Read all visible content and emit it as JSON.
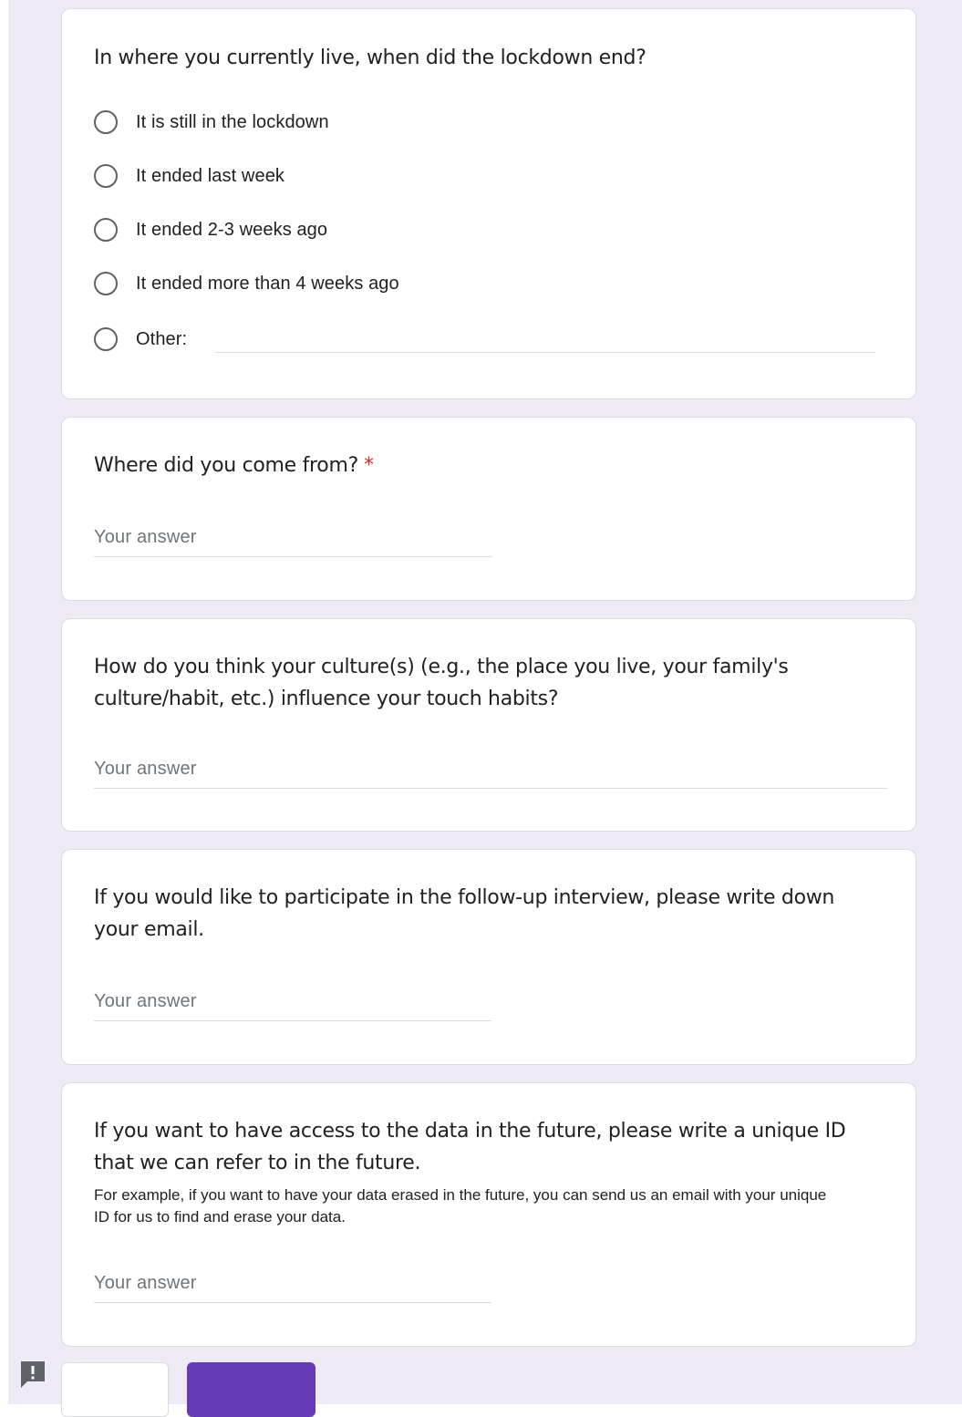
{
  "questions": [
    {
      "title": "In where you currently live, when did the lockdown end?",
      "type": "radio",
      "options": [
        "It is still in the lockdown",
        "It ended last week",
        "It ended 2-3 weeks ago",
        "It ended more than 4 weeks ago",
        "Other:"
      ]
    },
    {
      "title": "Where did you come from?",
      "required_mark": "*",
      "placeholder": "Your answer"
    },
    {
      "title": "How do you think your culture(s) (e.g., the place you live, your family's culture/habit, etc.) influence your touch habits?",
      "placeholder": "Your answer"
    },
    {
      "title": "If you would like to participate in the follow-up interview, please write down your email.",
      "placeholder": "Your answer"
    },
    {
      "title": "If you want to have access to the data in the future, please write a unique ID that we can refer to in the future.",
      "description": "For example, if you want to have your data erased in the future, you can send us an email with your unique ID for us to find and erase your data.",
      "placeholder": "Your answer"
    }
  ],
  "colors": {
    "page_background": "#efebf6",
    "accent": "#673ab7",
    "required": "#d93025"
  },
  "icons": {
    "feedback": "report-feedback-icon"
  }
}
